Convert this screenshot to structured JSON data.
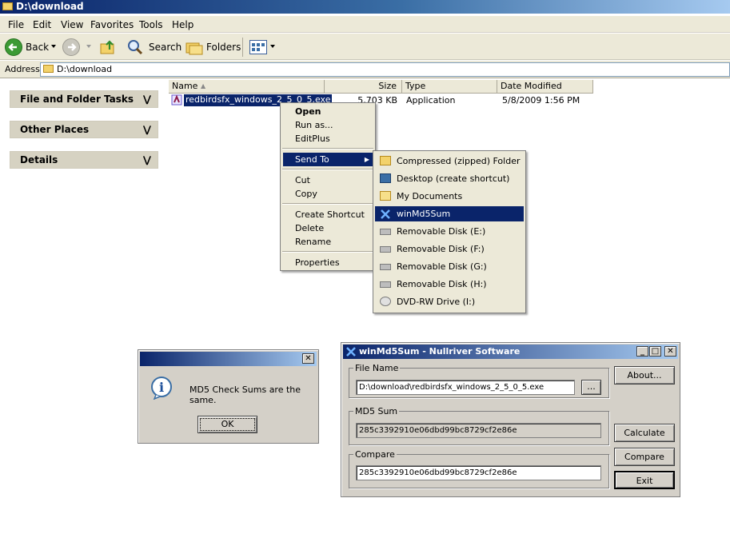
{
  "window": {
    "title": "D:\\download"
  },
  "menubar": [
    "File",
    "Edit",
    "View",
    "Favorites",
    "Tools",
    "Help"
  ],
  "toolbar": {
    "back": "Back",
    "search": "Search",
    "folders": "Folders"
  },
  "address": {
    "label": "Address",
    "value": "D:\\download"
  },
  "taskpane": {
    "sections": [
      "File and Folder Tasks",
      "Other Places",
      "Details"
    ]
  },
  "filelist": {
    "columns": [
      "Name",
      "Size",
      "Type",
      "Date Modified"
    ],
    "rows": [
      {
        "name": "redbirdsfx_windows_2_5_0_5.exe",
        "size": "5,703 KB",
        "type": "Application",
        "modified": "5/8/2009 1:56 PM"
      }
    ]
  },
  "context_menu": {
    "items": [
      "Open",
      "Run as...",
      "EditPlus",
      "Send To",
      "Cut",
      "Copy",
      "Create Shortcut",
      "Delete",
      "Rename",
      "Properties"
    ]
  },
  "sendto_menu": {
    "items": [
      "Compressed (zipped) Folder",
      "Desktop (create shortcut)",
      "My Documents",
      "winMd5Sum",
      "Removable Disk (E:)",
      "Removable Disk (F:)",
      "Removable Disk (G:)",
      "Removable Disk (H:)",
      "DVD-RW Drive (I:)"
    ]
  },
  "msgbox": {
    "message": "MD5 Check Sums are the same.",
    "ok": "OK"
  },
  "md5win": {
    "title": "winMd5Sum - Nullriver Software",
    "file_name_label": "File Name",
    "file_name": "D:\\download\\redbirdsfx_windows_2_5_0_5.exe",
    "browse": "...",
    "md5_label": "MD5 Sum",
    "md5": "285c3392910e06dbd99bc8729cf2e86e",
    "compare_label": "Compare",
    "compare": "285c3392910e06dbd99bc8729cf2e86e",
    "about": "About...",
    "calculate": "Calculate",
    "compare_btn": "Compare",
    "exit": "Exit"
  },
  "colors": {
    "selection": "#0a246a",
    "face": "#ece9d8",
    "dialog": "#d4d0c8"
  }
}
